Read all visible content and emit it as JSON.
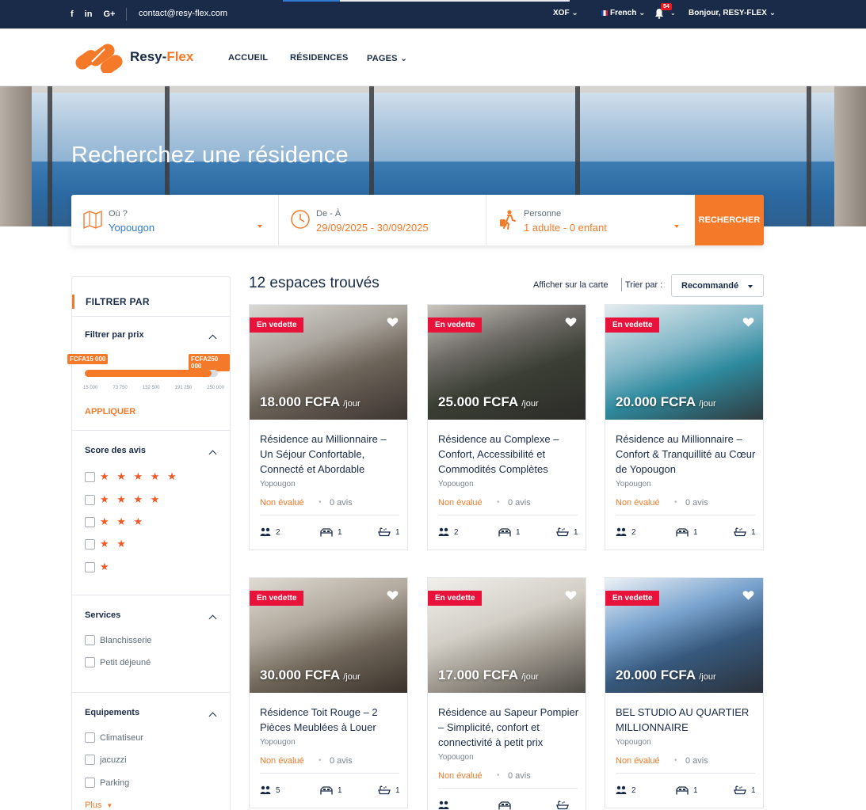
{
  "topbar": {
    "social": [
      {
        "name": "facebook-icon",
        "label": "f"
      },
      {
        "name": "linkedin-icon",
        "label": "in"
      },
      {
        "name": "google-plus-icon",
        "label": "G+"
      }
    ],
    "email": "contact@resy-flex.com",
    "currency": "XOF",
    "language": "French",
    "notifications": "54",
    "greeting": "Bonjour, RESY-FLEX"
  },
  "header": {
    "logo_text_main": "Resy-",
    "logo_text_accent": "Flex",
    "nav": [
      "ACCUEIL",
      "RÉSIDENCES",
      "PAGES"
    ]
  },
  "hero": {
    "title": "Recherchez une résidence"
  },
  "search": {
    "where_label": "Où ?",
    "where_value": "Yopougon",
    "dates_label": "De - À",
    "dates_value": "29/09/2025 - 30/09/2025",
    "persons_label": "Personne",
    "persons_value": "1 adulte - 0 enfant",
    "button": "RECHERCHER"
  },
  "sidebar": {
    "heading": "FILTRER PAR",
    "price": {
      "title": "Filtrer par prix",
      "min_tag": "FCFA15 000",
      "max_tag": "FCFA250 000",
      "ticks": [
        "15 000",
        "73 750",
        "132 500",
        "191 250",
        "250 000"
      ],
      "range_fraction": 0.95,
      "apply": "APPLIQUER"
    },
    "reviews": {
      "title": "Score des avis",
      "options": [
        "★ ★ ★ ★ ★",
        "★ ★ ★ ★",
        "★ ★ ★",
        "★ ★",
        "★"
      ]
    },
    "services": {
      "title": "Services",
      "options": [
        "Blanchisserie",
        "Petit déjeuné"
      ]
    },
    "equipements": {
      "title": "Equipements",
      "options": [
        "Climatiseur",
        "jacuzzi",
        "Parking"
      ],
      "more": "Plus"
    }
  },
  "results": {
    "count_title": "12 espaces trouvés",
    "map_link": "Afficher sur la carte",
    "sort_label": "Trier par :",
    "sort_value": "Recommandé"
  },
  "cards": [
    {
      "badge": "En vedette",
      "price": "18.000 FCFA",
      "per": "/jour",
      "title": "Résidence au Millionnaire – Un Séjour Confortable, Connecté et Abordable",
      "location": "Yopougon",
      "rating": "Non évalué",
      "reviews": "0 avis",
      "guests": "2",
      "beds": "1",
      "baths": "1"
    },
    {
      "badge": "En vedette",
      "price": "25.000 FCFA",
      "per": "/jour",
      "title": "Résidence au Complexe – Confort, Accessibilité et Commodités Complètes",
      "location": "Yopougon",
      "rating": "Non évalué",
      "reviews": "0 avis",
      "guests": "2",
      "beds": "1",
      "baths": "1"
    },
    {
      "badge": "En vedette",
      "price": "20.000 FCFA",
      "per": "/jour",
      "title": "Résidence au Millionnaire – Confort & Tranquillité au Cœur de Yopougon",
      "location": "Yopougon",
      "rating": "Non évalué",
      "reviews": "0 avis",
      "guests": "2",
      "beds": "1",
      "baths": "1"
    },
    {
      "badge": "En vedette",
      "price": "30.000 FCFA",
      "per": "/jour",
      "title": "Résidence Toit Rouge – 2 Pièces Meublées à Louer",
      "location": "Yopougon",
      "rating": "Non évalué",
      "reviews": "0 avis",
      "guests": "5",
      "beds": "1",
      "baths": "1"
    },
    {
      "badge": "En vedette",
      "price": "17.000 FCFA",
      "per": "/jour",
      "title": "Résidence au Sapeur Pompier – Simplicité, confort et connectivité à petit prix",
      "location": "Yopougon",
      "rating": "Non évalué",
      "reviews": "0 avis",
      "guests": "",
      "beds": "",
      "baths": ""
    },
    {
      "badge": "En vedette",
      "price": "20.000 FCFA",
      "per": "/jour",
      "title": "BEL STUDIO AU QUARTIER MILLIONNAIRE",
      "location": "Yopougon",
      "rating": "Non évalué",
      "reviews": "0 avis",
      "guests": "2",
      "beds": "1",
      "baths": "1"
    }
  ],
  "colors": {
    "navy": "#1a2b49",
    "accent": "#f47a2a",
    "badge_red": "#e8123b"
  }
}
